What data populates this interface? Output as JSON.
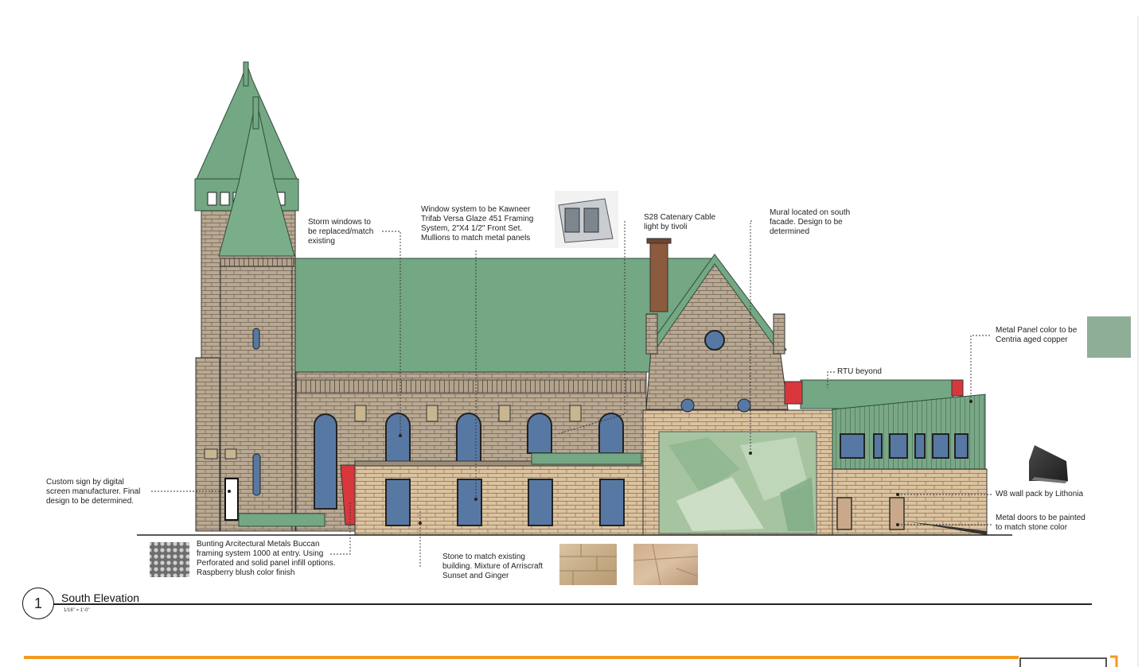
{
  "drawing": {
    "number": "1",
    "title": "South Elevation",
    "scale": "1/16\" = 1'-0\""
  },
  "notes": {
    "storm_windows": "Storm windows to\nbe replaced/match\nexisting",
    "window_system": "Window system to be Kawneer\nTrifab Versa Glaze 451 Framing\nSystem, 2\"X4 1/2\" Front Set.\nMullions to match metal panels",
    "catenary": "S28 Catenary Cable\nlight by tivoli",
    "mural": "Mural located on south\nfacade. Design to be\ndetermined",
    "metal_panel": "Metal Panel color to be\nCentria aged copper",
    "rtu": "RTU beyond",
    "custom_sign": "Custom sign by digital\nscreen manufacturer. Final\ndesign to be determined.",
    "bunting": "Bunting Arcitectural Metals Buccan\nframing system 1000 at entry. Using\nPerforated and solid panel infill options.\nRaspberry blush color finish",
    "stone": "Stone to match existing\nbuilding. Mixture of Arriscraft\nSunset and Ginger",
    "wall_pack": "W8 wall pack by Lithonia",
    "metal_doors": "Metal doors to be painted\nto match stone color"
  },
  "colors": {
    "roof_green": "#74a784",
    "panel_swatch": "#8fae98",
    "stone_tan": "#bba894",
    "brick_tan": "#d9bf9c",
    "window_blue": "#5778a3",
    "accent_red": "#d8383c",
    "chimney": "#8c5a3c",
    "border_orange": "#f29a1f"
  }
}
